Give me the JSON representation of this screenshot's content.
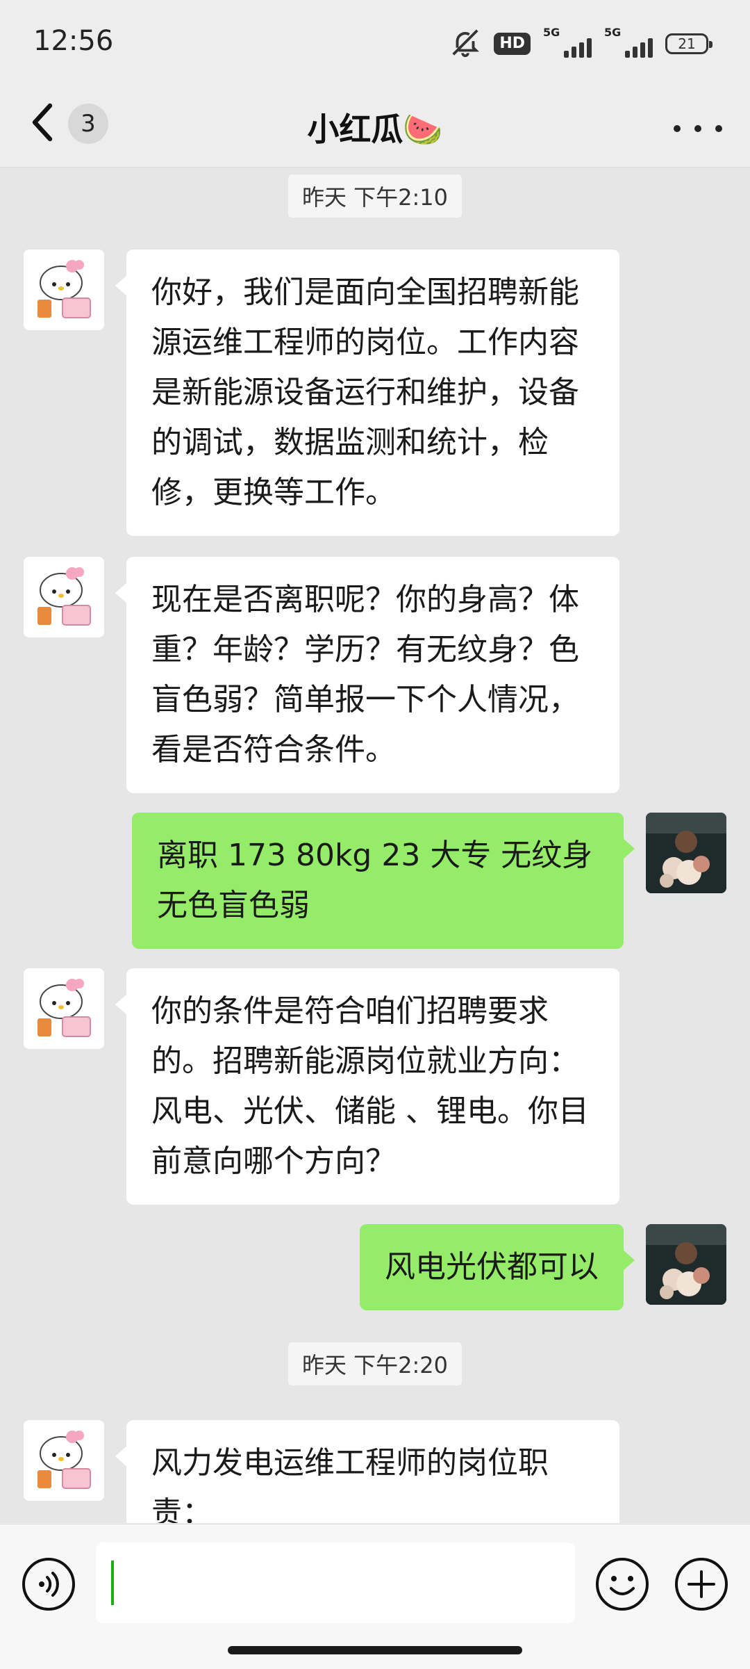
{
  "status_bar": {
    "time": "12:56",
    "hd_label": "HD",
    "network_label_1": "5G",
    "network_label_2": "5G",
    "battery": "21"
  },
  "header": {
    "unread_count": "3",
    "title": "小红瓜🍉"
  },
  "messages": [
    {
      "type": "timestamp",
      "text": "昨天 下午2:10"
    },
    {
      "type": "received",
      "text": "你好，我们是面向全国招聘新能源运维工程师的岗位。工作内容是新能源设备运行和维护，设备的调试，数据监测和统计，检修，更换等工作。"
    },
    {
      "type": "received",
      "text": "现在是否离职呢？你的身高？体重？年龄？学历？有无纹身？色盲色弱？简单报一下个人情况，看是否符合条件。"
    },
    {
      "type": "sent",
      "text": "离职  173  80kg  23 大专 无纹身  无色盲色弱"
    },
    {
      "type": "received",
      "text": "你的条件是符合咱们招聘要求的。招聘新能源岗位就业方向：风电、光伏、储能 、锂电。你目前意向哪个方向？"
    },
    {
      "type": "sent",
      "text": "风电光伏都可以"
    },
    {
      "type": "timestamp",
      "text": "昨天 下午2:20"
    },
    {
      "type": "received",
      "text": "风力发电运维工程师的岗位职责："
    }
  ],
  "colors": {
    "sent_bubble": "#95ec69",
    "received_bubble": "#ffffff",
    "chat_background": "#e6e6e6"
  },
  "icons": {
    "back": "chevron-left-icon",
    "more": "more-horizontal-icon",
    "voice": "voice-icon",
    "emoji": "emoji-icon",
    "plus": "plus-circle-icon"
  }
}
